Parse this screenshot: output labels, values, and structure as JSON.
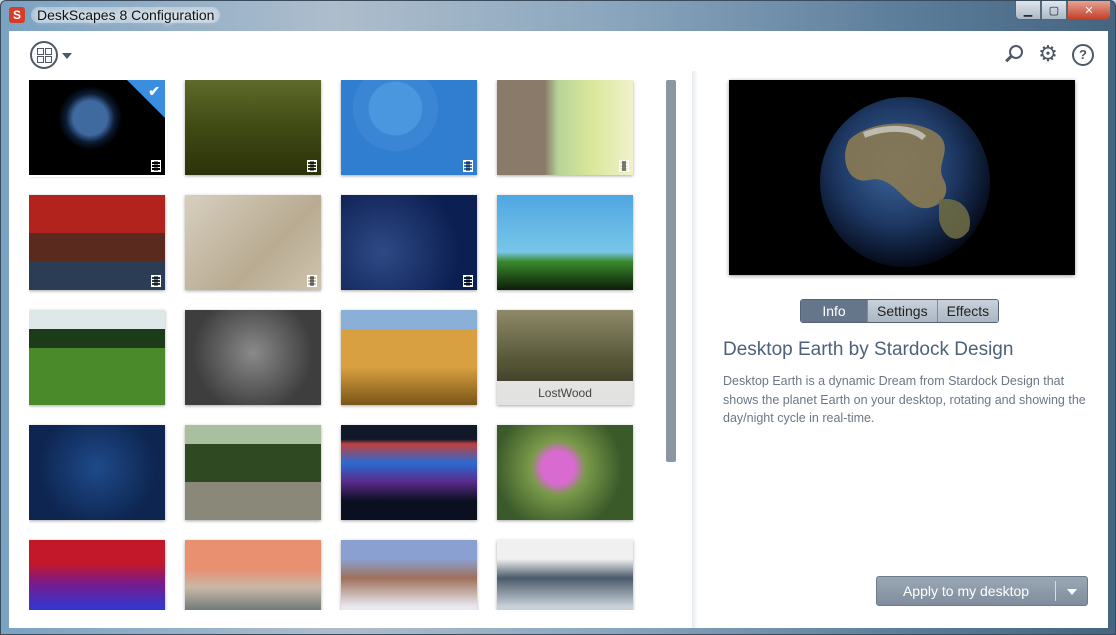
{
  "window": {
    "title": "DeskScapes 8 Configuration",
    "app_icon_letter": "S",
    "controls": {
      "minimize": "▁",
      "maximize": "▢",
      "close": "✕"
    }
  },
  "toolbar": {
    "view_icon": "grid-view-icon",
    "search_icon": "search-icon",
    "settings_icon": "gear-icon",
    "help_icon": "help-icon",
    "help_glyph": "?"
  },
  "dreams": [
    {
      "label": "",
      "video": true,
      "selected": true,
      "icon": "earth"
    },
    {
      "label": "",
      "video": true,
      "selected": false,
      "icon": "grass"
    },
    {
      "label": "",
      "video": true,
      "selected": false,
      "icon": "blue-circles"
    },
    {
      "label": "",
      "video": true,
      "selected": false,
      "icon": "tree-bark"
    },
    {
      "label": "",
      "video": true,
      "selected": false,
      "icon": "car-girl"
    },
    {
      "label": "",
      "video": true,
      "selected": false,
      "icon": "sand"
    },
    {
      "label": "",
      "video": true,
      "selected": false,
      "icon": "snow-night"
    },
    {
      "label": "",
      "video": false,
      "selected": false,
      "icon": "floating-tree"
    },
    {
      "label": "",
      "video": false,
      "selected": false,
      "icon": "golf-ball"
    },
    {
      "label": "",
      "video": false,
      "selected": false,
      "icon": "cats"
    },
    {
      "label": "",
      "video": false,
      "selected": false,
      "icon": "wheat"
    },
    {
      "label": "LostWood",
      "video": false,
      "selected": false,
      "icon": "lostwood"
    },
    {
      "label": "",
      "video": false,
      "selected": false,
      "icon": "orbs"
    },
    {
      "label": "",
      "video": false,
      "selected": false,
      "icon": "tree-road"
    },
    {
      "label": "",
      "video": false,
      "selected": false,
      "icon": "aurora"
    },
    {
      "label": "",
      "video": false,
      "selected": false,
      "icon": "daisy"
    },
    {
      "label": "",
      "video": false,
      "selected": false,
      "icon": "equalizer"
    },
    {
      "label": "",
      "video": false,
      "selected": false,
      "icon": "mountains-mist"
    },
    {
      "label": "",
      "video": false,
      "selected": false,
      "icon": "great-wall"
    },
    {
      "label": "",
      "video": false,
      "selected": false,
      "icon": "snowy-peaks"
    }
  ],
  "tabs": [
    {
      "label": "Info",
      "active": true
    },
    {
      "label": "Settings",
      "active": false
    },
    {
      "label": "Effects",
      "active": false
    }
  ],
  "details": {
    "title": "Desktop Earth by Stardock Design",
    "description": "Desktop Earth is a dynamic Dream from Stardock Design that shows the planet Earth on your desktop, rotating and showing the day/night cycle in real-time."
  },
  "apply": {
    "label": "Apply to my desktop"
  },
  "colors": {
    "accent": "#3a8ee0",
    "tab_active": "#66768a",
    "title_text": "#4d6278"
  }
}
